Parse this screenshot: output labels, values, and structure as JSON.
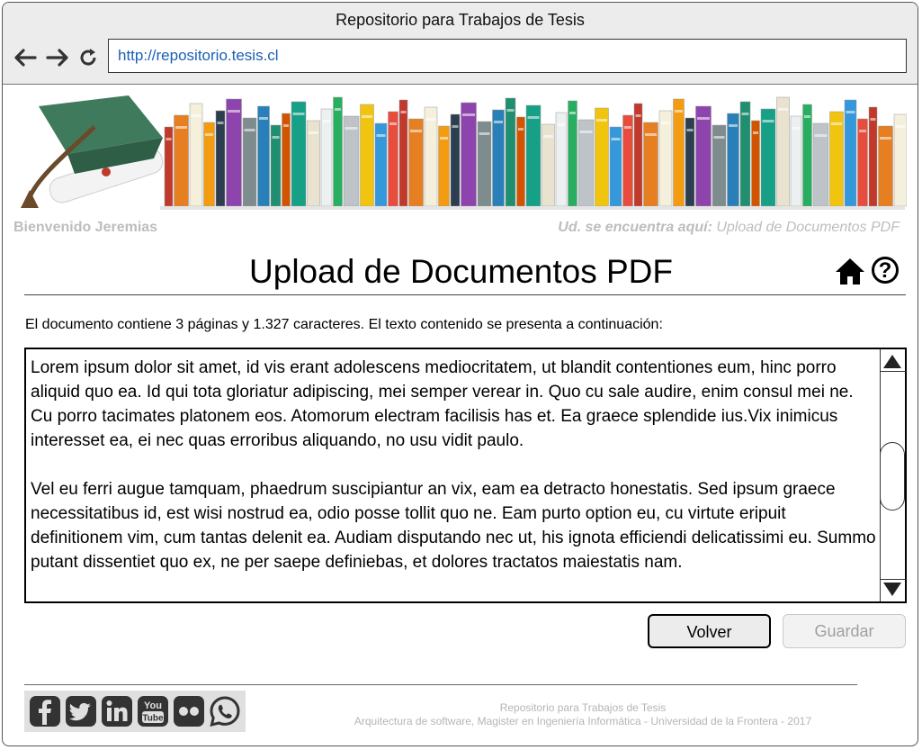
{
  "window": {
    "title": "Repositorio para Trabajos de Tesis"
  },
  "browser": {
    "url": "http://repositorio.tesis.cl",
    "icons": [
      "back-arrow-icon",
      "forward-arrow-icon",
      "reload-icon"
    ]
  },
  "header": {
    "welcome": "Bienvenido Jeremias",
    "breadcrumb_label": "Ud. se encuentra aquí:",
    "breadcrumb_page": "Upload de Documentos PDF"
  },
  "page": {
    "title": "Upload de Documentos PDF",
    "info": "El documento contiene 3 páginas y 1.327 caracteres. El texto contenido se presenta a continuación:",
    "paragraphs": [
      "Lorem ipsum dolor sit amet, id vis erant adolescens mediocritatem, ut blandit contentiones eum, hinc porro aliquid quo ea. Id qui tota gloriatur adipiscing, mei semper verear in. Quo cu sale audire, enim consul mei ne. Cu porro tacimates platonem eos. Atomorum electram facilisis has et. Ea graece splendide ius.Vix inimicus interesset ea, ei nec quas erroribus aliquando, no usu vidit paulo.",
      "Vel eu ferri augue tamquam, phaedrum suscipiantur an vix, eam ea detracto honestatis. Sed ipsum graece necessitatibus id, est wisi nostrud ea, odio posse tollit quo ne. Eam purto option eu, cu virtute eripuit definitionem vim, cum tantas delenit ea. Audiam disputando nec ut, his ignota efficiendi delicatissimi eu. Summo putant dissentiet quo ex, ne per saepe definiebas, et dolores tractatos maiestatis nam."
    ],
    "buttons": {
      "back": "Volver",
      "save": "Guardar"
    }
  },
  "footer": {
    "line1": "Repositorio para Trabajos de Tesis",
    "line2": "Arquitectura de software, Magister en Ingeniería Informática - Universidad de la Frontera - 2017",
    "social_icons": [
      "facebook-icon",
      "twitter-icon",
      "linkedin-icon",
      "youtube-icon",
      "flickr-icon",
      "whatsapp-icon"
    ]
  },
  "colors": {
    "url_text": "#1a5fb4",
    "muted_text": "#bdbdbd",
    "cap_green": "#3f7a5c"
  }
}
